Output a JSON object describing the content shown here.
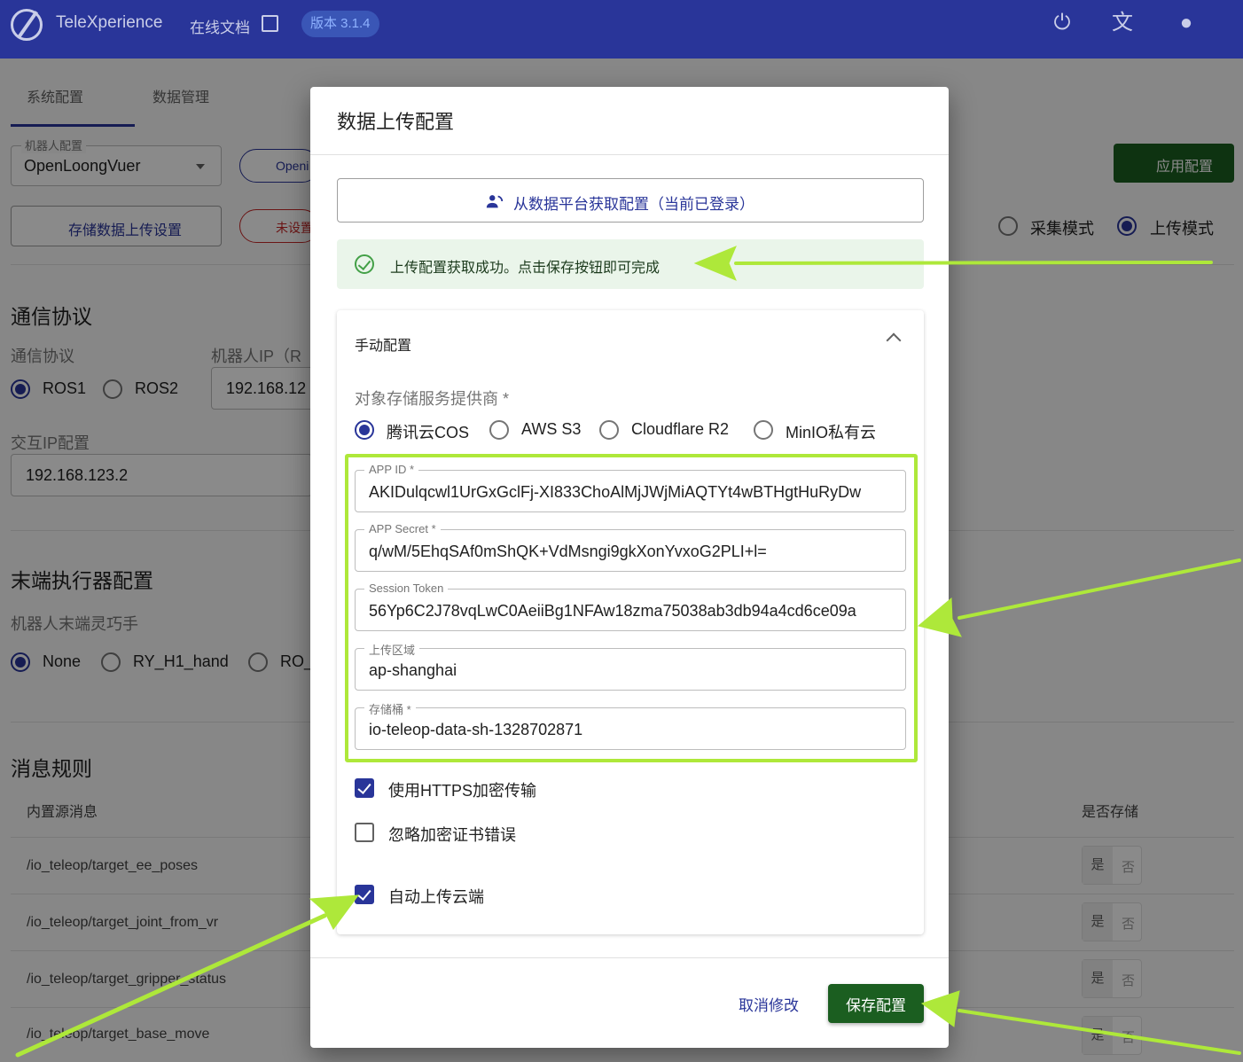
{
  "topbar": {
    "brand": "TeleXperience",
    "docs_link": "在线文档",
    "version": "版本 3.1.4",
    "icons": [
      "power-icon",
      "translate-icon",
      "account-icon"
    ]
  },
  "background": {
    "tabs": [
      "系统配置",
      "数据管理"
    ],
    "robot_config_legend": "机器人配置",
    "robot_select_value": "OpenLoongVuer",
    "chip_open": "Openi",
    "storage_btn": "存储数据上传设置",
    "warning_chip": "未设置",
    "apply_btn": "应用配置",
    "modes": [
      "采集模式",
      "上传模式"
    ],
    "comm_title": "通信协议",
    "comm_label": "通信协议",
    "robot_ip_label": "机器人IP（R",
    "ros_options": [
      "ROS1",
      "ROS2"
    ],
    "robot_ip_value": "192.168.12",
    "interact_ip_label": "交互IP配置",
    "interact_ip_value": "192.168.123.2",
    "ee_title": "末端执行器配置",
    "ee_label": "机器人末端灵巧手",
    "ee_options": [
      "None",
      "RY_H1_hand",
      "RO_"
    ],
    "msg_title": "消息规则",
    "msg_col1": "内置源消息",
    "msg_col2": "是否存储",
    "rows": [
      "/io_teleop/target_ee_poses",
      "/io_teleop/target_joint_from_vr",
      "/io_teleop/target_gripper_status",
      "/io_teleop/target_base_move"
    ],
    "yes": "是",
    "no": "否"
  },
  "dialog": {
    "title": "数据上传配置",
    "fetch_btn": "从数据平台获取配置（当前已登录）",
    "alert": "上传配置获取成功。点击保存按钮即可完成",
    "manual_title": "手动配置",
    "provider_label": "对象存储服务提供商 *",
    "providers": [
      "腾讯云COS",
      "AWS S3",
      "Cloudflare R2",
      "MinIO私有云"
    ],
    "fields": {
      "app_id": {
        "label": "APP ID *",
        "value": "AKIDulqcwl1UrGxGclFj-XI833ChoAlMjJWjMiAQTYt4wBTHgtHuRyDw"
      },
      "app_secret": {
        "label": "APP Secret *",
        "value": "q/wM/5EhqSAf0mShQK+VdMsngi9gkXonYvxoG2PLI+l="
      },
      "session_token": {
        "label": "Session Token",
        "value": "56Yp6C2J78vqLwC0AeiiBg1NFAw18zma75038ab3db94a4cd6ce09a"
      },
      "region": {
        "label": "上传区域",
        "value": "ap-shanghai"
      },
      "bucket": {
        "label": "存储桶 *",
        "value": "io-teleop-data-sh-1328702871"
      }
    },
    "checkboxes": {
      "https": "使用HTTPS加密传输",
      "ignore_cert": "忽略加密证书错误",
      "auto_upload": "自动上传云端"
    },
    "cancel": "取消修改",
    "save": "保存配置"
  },
  "colors": {
    "primary": "#293599",
    "success_green": "#1b5e20",
    "highlight": "#aee83a"
  }
}
